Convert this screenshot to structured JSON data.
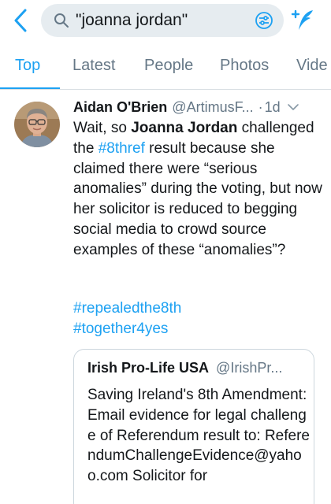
{
  "search": {
    "query": "\"joanna jordan\""
  },
  "colors": {
    "accent": "#1da1f2",
    "secondary_text": "#657786",
    "search_field_bg": "#e6ecf0"
  },
  "icons": {
    "back": "chevron-left-icon",
    "search": "search-icon",
    "filter": "filter-icon",
    "compose": "compose-icon",
    "caret": "chevron-down-icon"
  },
  "tabs": [
    {
      "label": "Top",
      "active": true
    },
    {
      "label": "Latest",
      "active": false
    },
    {
      "label": "People",
      "active": false
    },
    {
      "label": "Photos",
      "active": false
    },
    {
      "label": "Vide",
      "active": false
    }
  ],
  "tweet": {
    "display_name": "Aidan O'Brien",
    "handle": "@ArtimusF...",
    "dot": "·",
    "timestamp": "1d",
    "text": {
      "p1": "Wait, so ",
      "bold": "Joanna Jordan",
      "p2": " challenged the ",
      "link": "#8thref",
      "p3": " result because she claimed there were “serious anomalies” during the voting, but now her solicitor is reduced to begging social media to crowd source examples of these “anomalies”?"
    },
    "hashtags": [
      "#repealedthe8th",
      "#together4yes"
    ],
    "quote": {
      "display_name": "Irish Pro-Life USA",
      "handle": "@IrishPr...",
      "text": "Saving Ireland's 8th Amendment: Email evidence for legal challenge of Referendum result to: ReferendumChallengeEvidence@yahoo.com Solicitor for"
    }
  }
}
